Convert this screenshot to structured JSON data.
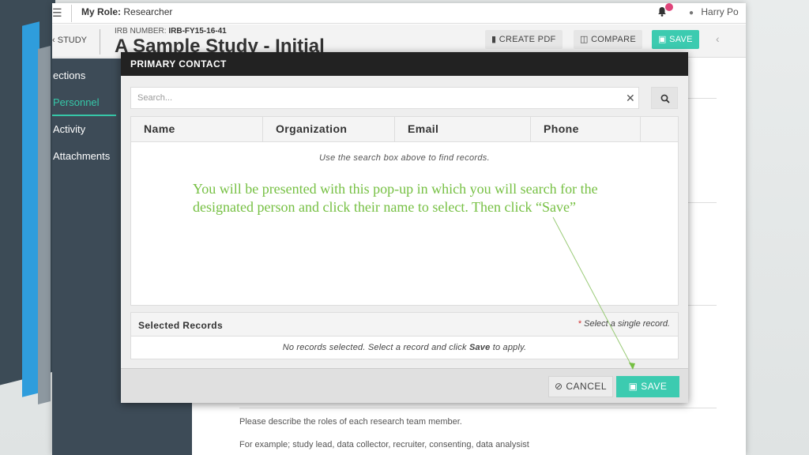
{
  "topbar": {
    "role_label": "My Role:",
    "role_value": "Researcher",
    "user_name": "Harry Po"
  },
  "header": {
    "back_label": "STUDY",
    "irb_label": "IRB NUMBER:",
    "irb_value": "IRB-FY15-16-41",
    "title": "A Sample Study - Initial",
    "create_pdf": "CREATE PDF",
    "compare": "COMPARE",
    "save": "SAVE"
  },
  "sidebar": {
    "items": [
      {
        "label": "ections",
        "active": false
      },
      {
        "label": "Personnel",
        "active": true
      },
      {
        "label": "Activity",
        "active": false
      },
      {
        "label": "Attachments",
        "active": false
      }
    ]
  },
  "content": {
    "describe": "Please describe the roles of each research team member.",
    "example": "For example; study lead, data collector, recruiter, consenting, data analysist"
  },
  "modal": {
    "title": "PRIMARY CONTACT",
    "search_placeholder": "Search...",
    "columns": [
      "Name",
      "Organization",
      "Email",
      "Phone"
    ],
    "empty_text": "Use the search box above to find records.",
    "selected_title": "Selected Records",
    "selected_hint_mark": "*",
    "selected_hint": "Select a single record.",
    "selected_empty_pre": "No records selected. Select a record and click",
    "selected_empty_bold": "Save",
    "selected_empty_post": "to apply.",
    "cancel": "CANCEL",
    "save": "SAVE"
  },
  "annotation": {
    "text": "You will be presented with this pop-up in which you will search for the designated person and click their name to select. Then click “Save”"
  },
  "colors": {
    "accent": "#3ccbb0",
    "sidebar_bg": "#3d4b57",
    "annotation": "#76c043",
    "modal_header": "#222222"
  }
}
